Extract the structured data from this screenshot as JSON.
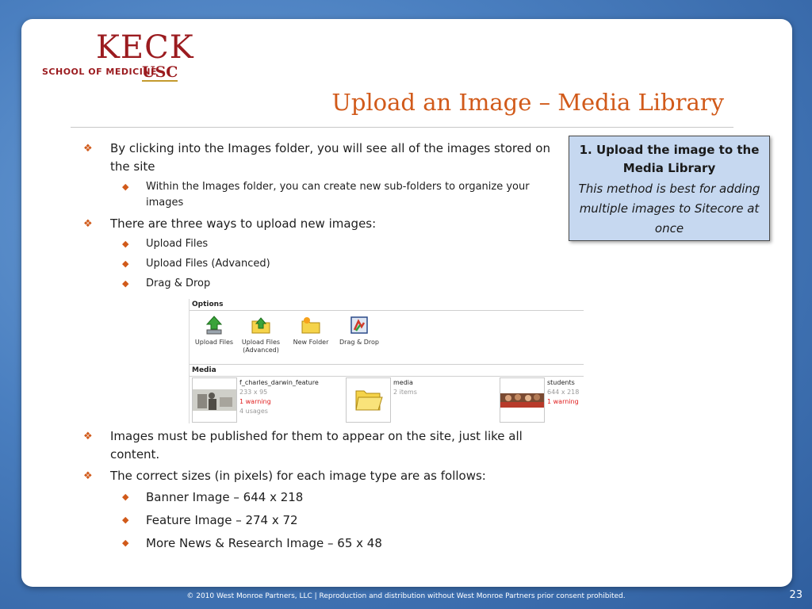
{
  "logo": {
    "name": "KECK",
    "school": "SCHOOL OF MEDICINE",
    "usc": "USC"
  },
  "title": "Upload an Image – Media Library",
  "bullets": [
    {
      "text": "By clicking into the Images folder, you will see all of the images stored on the site",
      "sub": [
        "Within the Images folder, you can create new sub-folders to organize your images"
      ]
    },
    {
      "text": "There are three ways to upload new images:",
      "sub": [
        "Upload Files",
        "Upload Files (Advanced)",
        "Drag & Drop"
      ]
    }
  ],
  "bullets2": [
    {
      "text": "Images must be published for them to appear on the site, just like all content."
    },
    {
      "text": "The correct sizes (in pixels) for each image type are as follows:",
      "sub": [
        "Banner Image – 644 x 218",
        "Feature Image – 274 x 72",
        "More News & Research Image – 65 x 48"
      ]
    }
  ],
  "callout": {
    "heading": "1. Upload the image to the Media Library",
    "body": "This method is best for adding multiple images to Sitecore at once"
  },
  "screenshot": {
    "options_label": "Options",
    "options": [
      {
        "label": "Upload Files",
        "icon": "upload-arrow-icon"
      },
      {
        "label": "Upload Files (Advanced)",
        "icon": "folder-upload-icon"
      },
      {
        "label": "New Folder",
        "icon": "new-folder-icon"
      },
      {
        "label": "Drag & Drop",
        "icon": "drag-drop-icon"
      }
    ],
    "media_label": "Media",
    "media": [
      {
        "name": "f_charles_darwin_feature",
        "size": "233 x 95",
        "warning": "1 warning",
        "usage": "4 usages"
      },
      {
        "name": "media",
        "size": "2 items"
      },
      {
        "name": "students",
        "size": "644 x 218",
        "warning": "1 warning"
      }
    ]
  },
  "page_number": "23",
  "footer": "© 2010 West Monroe Partners, LLC  |  Reproduction and distribution without West Monroe Partners prior consent prohibited.",
  "colors": {
    "accent": "#d15a1a",
    "logo": "#9b1b1f",
    "callout_bg": "#c6d8f0"
  }
}
